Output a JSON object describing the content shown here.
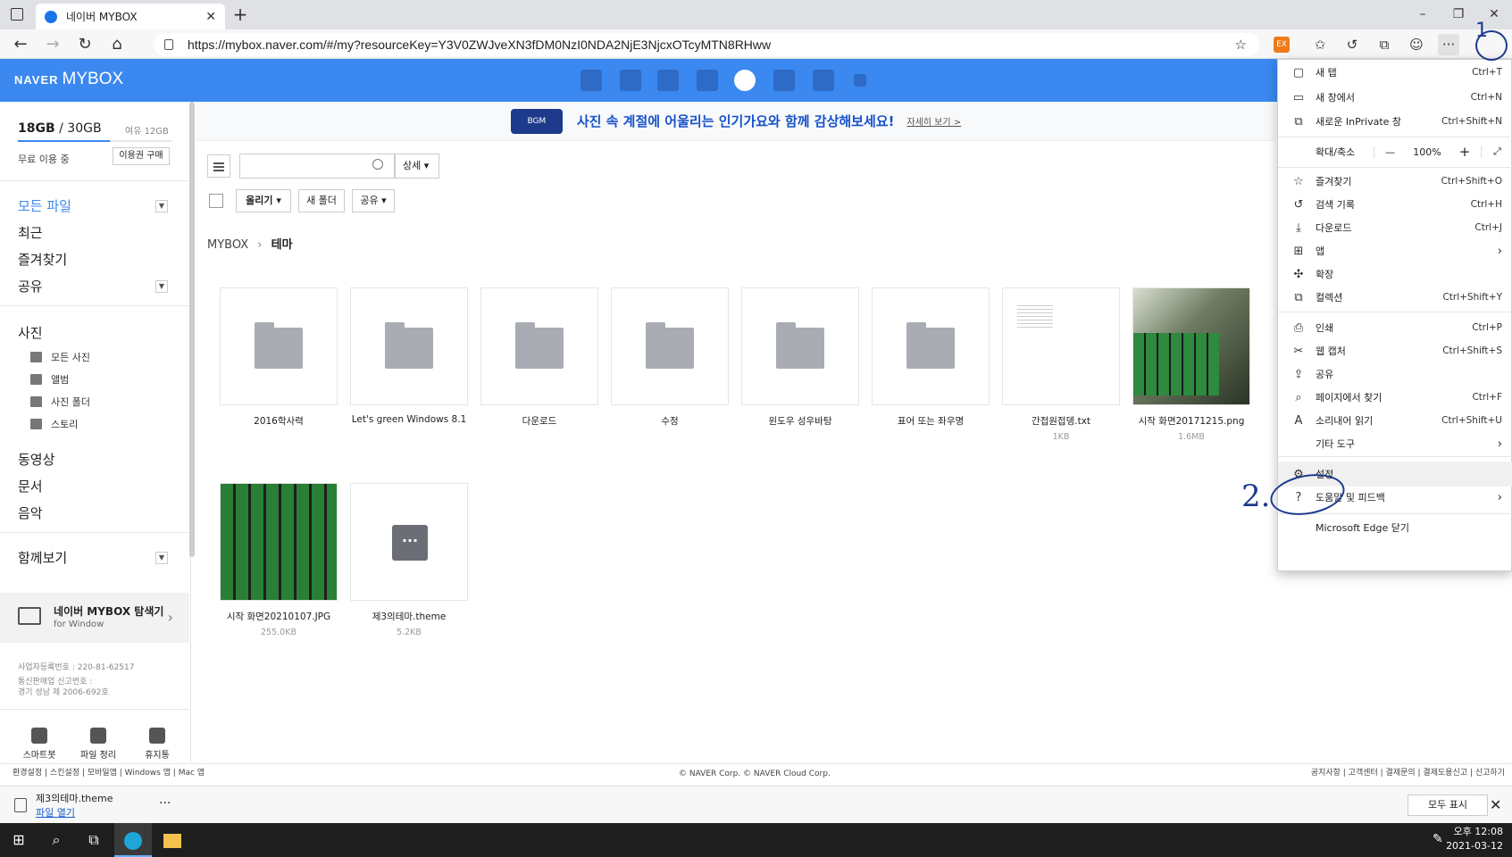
{
  "browser": {
    "tab_title": "네이버 MYBOX",
    "url": "https://mybox.naver.com/#/my?resourceKey=Y3V0ZWJveXN3fDM0NzI0NDA2NjE3NjcxOTcyMTN8RHww",
    "window_controls": [
      "–",
      "❐",
      "✕"
    ]
  },
  "header": {
    "logo_naver": "NAVER",
    "logo_mybox": "MYBOX"
  },
  "sidebar": {
    "storage_used": "18GB",
    "storage_total": "30GB",
    "storage_free": "여유 12GB",
    "plan": "무료 이용 중",
    "buy_button": "이용권 구매",
    "all_files": "모든 파일",
    "recent": "최근",
    "favorites": "즐겨찾기",
    "share": "공유",
    "photos": "사진",
    "photo_items": [
      "모든 사진",
      "앨범",
      "사진 폴더",
      "스토리"
    ],
    "video": "동영상",
    "documents": "문서",
    "music": "음악",
    "together": "함께보기",
    "explorer_title": "네이버 MYBOX 탐색기",
    "explorer_sub": "for Window",
    "biz_lines": [
      "사업자등록번호 : 220-81-62517",
      "통신판매업 신고번호 :",
      "경기 성남 제 2006-692호"
    ],
    "bottom": [
      "스마트봇",
      "파일 정리",
      "휴지통"
    ]
  },
  "banner": {
    "badge": "BGM",
    "text": "사진 속 계절에 어울리는 인기가요와 함께 감상해보세요!",
    "more": "자세히 보기 >"
  },
  "toolbar": {
    "search_placeholder": "",
    "detail": "상세",
    "upload": "올리기",
    "new_folder": "새 폴더",
    "share": "공유"
  },
  "breadcrumb": {
    "root": "MYBOX",
    "current": "테마"
  },
  "files": [
    {
      "name": "2016학사력",
      "size": "",
      "kind": "folder"
    },
    {
      "name": "Let's green Windows 8.1",
      "size": "",
      "kind": "folder"
    },
    {
      "name": "다운로드",
      "size": "",
      "kind": "folder"
    },
    {
      "name": "수정",
      "size": "",
      "kind": "folder"
    },
    {
      "name": "윈도우 성우바탕",
      "size": "",
      "kind": "folder"
    },
    {
      "name": "표어 또는 좌우명",
      "size": "",
      "kind": "folder"
    },
    {
      "name": "간접원접뎅.txt",
      "size": "1KB",
      "kind": "text"
    },
    {
      "name": "시작 화면20171215.png",
      "size": "1.6MB",
      "kind": "image"
    },
    {
      "name": "시작 화면20210107.JPG",
      "size": "255.0KB",
      "kind": "image2"
    },
    {
      "name": "제3의테마.theme",
      "size": "5.2KB",
      "kind": "theme"
    }
  ],
  "edge_menu": {
    "items": [
      {
        "icon": "new-tab-icon",
        "glyph": "▢",
        "label": "새 탭",
        "shortcut": "Ctrl+T"
      },
      {
        "icon": "new-window-icon",
        "glyph": "▭",
        "label": "새 창에서",
        "shortcut": "Ctrl+N"
      },
      {
        "icon": "inprivate-icon",
        "glyph": "⧉",
        "label": "새로운 InPrivate 창",
        "shortcut": "Ctrl+Shift+N"
      }
    ],
    "zoom_label": "확대/축소",
    "zoom_value": "100%",
    "items2": [
      {
        "icon": "favorites-icon",
        "glyph": "☆",
        "label": "즐겨찾기",
        "shortcut": "Ctrl+Shift+O"
      },
      {
        "icon": "history-icon",
        "glyph": "↺",
        "label": "검색 기록",
        "shortcut": "Ctrl+H"
      },
      {
        "icon": "download-icon",
        "glyph": "⤓",
        "label": "다운로드",
        "shortcut": "Ctrl+J"
      },
      {
        "icon": "apps-icon",
        "glyph": "⊞",
        "label": "앱",
        "shortcut": "",
        "chev": true
      },
      {
        "icon": "extensions-icon",
        "glyph": "✣",
        "label": "확장",
        "shortcut": ""
      },
      {
        "icon": "collections-icon",
        "glyph": "⧉",
        "label": "컬렉션",
        "shortcut": "Ctrl+Shift+Y"
      }
    ],
    "items3": [
      {
        "icon": "print-icon",
        "glyph": "⎙",
        "label": "인쇄",
        "shortcut": "Ctrl+P"
      },
      {
        "icon": "web-capture-icon",
        "glyph": "✂",
        "label": "웹 캡처",
        "shortcut": "Ctrl+Shift+S"
      },
      {
        "icon": "share-icon",
        "glyph": "⇪",
        "label": "공유",
        "shortcut": ""
      },
      {
        "icon": "find-icon",
        "glyph": "⌕",
        "label": "페이지에서 찾기",
        "shortcut": "Ctrl+F"
      },
      {
        "icon": "read-aloud-icon",
        "glyph": "A",
        "label": "소리내어 읽기",
        "shortcut": "Ctrl+Shift+U"
      },
      {
        "icon": "more-tools-icon",
        "glyph": "",
        "label": "기타 도구",
        "shortcut": "",
        "chev": true
      }
    ],
    "items4": [
      {
        "icon": "settings-icon",
        "glyph": "⚙",
        "label": "설정",
        "shortcut": ""
      },
      {
        "icon": "help-icon",
        "glyph": "?",
        "label": "도움말 및 피드백",
        "shortcut": "",
        "chev": true
      }
    ],
    "close_edge": "Microsoft Edge 닫기"
  },
  "annotations": {
    "one": "1",
    "two": "2."
  },
  "footer": {
    "links": "환경설정 | 스킨설정 | 모바일앱 | Windows 앱 | Mac 앱",
    "copyright": "© NAVER Corp. © NAVER Cloud Corp.",
    "right": "공지사항 | 고객센터 | 결제문의 | 결제도용신고 | 신고하기"
  },
  "download_bar": {
    "file": "제3의테마.theme",
    "open": "파일 열기",
    "show_all": "모두 표시"
  },
  "taskbar": {
    "time": "오후 12:08",
    "date": "2021-03-12"
  },
  "colors": {
    "accent": "#3a88f0",
    "annotation": "#1b3a8f"
  }
}
